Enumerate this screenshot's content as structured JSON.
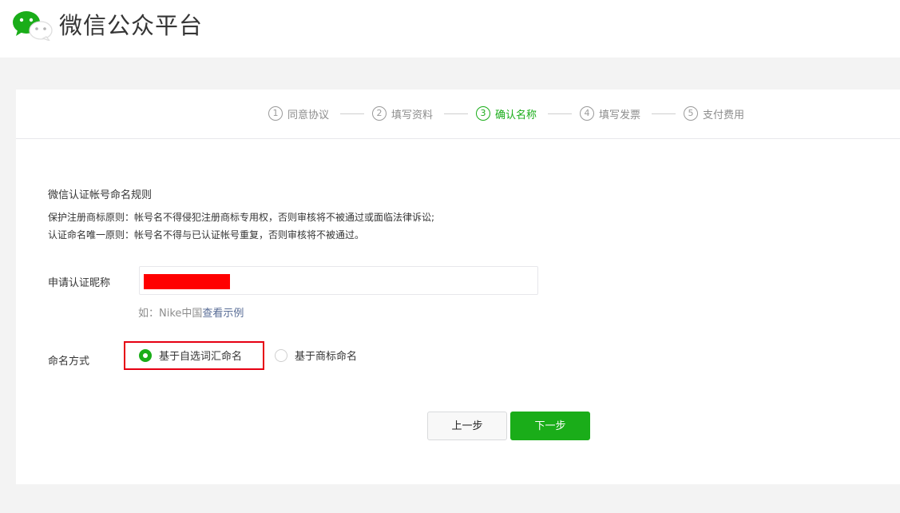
{
  "header": {
    "title": "微信公众平台",
    "logo_icon": "wechat-logo-icon"
  },
  "steps": [
    {
      "num": "1",
      "label": "同意协议",
      "active": false
    },
    {
      "num": "2",
      "label": "填写资料",
      "active": false
    },
    {
      "num": "3",
      "label": "确认名称",
      "active": true
    },
    {
      "num": "4",
      "label": "填写发票",
      "active": false
    },
    {
      "num": "5",
      "label": "支付费用",
      "active": false
    }
  ],
  "rules": {
    "title": "微信认证帐号命名规则",
    "items": [
      "保护注册商标原则：帐号名不得侵犯注册商标专用权，否则审核将不被通过或面临法律诉讼;",
      "认证命名唯一原则：帐号名不得与已认证帐号重复，否则审核将不被通过。"
    ]
  },
  "nickname": {
    "label": "申请认证昵称",
    "example_prefix": "如：Nike中国",
    "example_link": "查看示例"
  },
  "naming": {
    "label": "命名方式",
    "options": [
      {
        "label": "基于自选词汇命名",
        "checked": true
      },
      {
        "label": "基于商标命名",
        "checked": false
      }
    ]
  },
  "buttons": {
    "prev": "上一步",
    "next": "下一步"
  },
  "colors": {
    "accent": "#1aad19",
    "highlight_border": "#e60012",
    "redaction": "#ff0000",
    "link": "#576b95"
  }
}
